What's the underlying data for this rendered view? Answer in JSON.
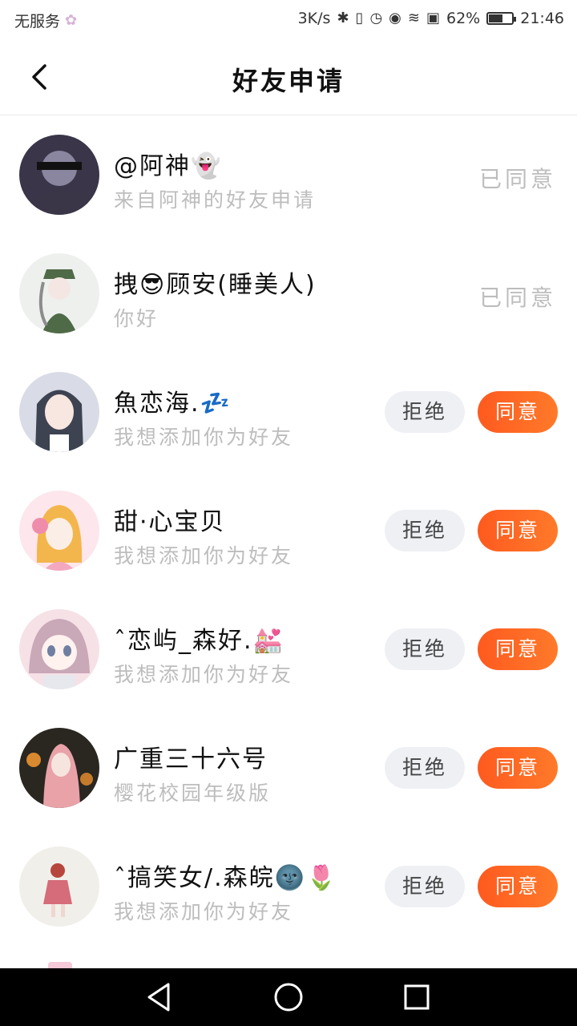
{
  "status_bar": {
    "carrier": "无服务",
    "net_speed": "3K/s",
    "battery_percent": "62%",
    "battery_level": 0.62,
    "time": "21:46",
    "icons": [
      "bluetooth-icon",
      "vibrate-icon",
      "alarm-icon",
      "eye-icon",
      "wifi-icon",
      "notice-icon",
      "battery-icon"
    ]
  },
  "header": {
    "title": "好友申请",
    "back_icon": "back-arrow-icon"
  },
  "requests": [
    {
      "name": "@阿神👻",
      "message": "来自阿神的好友申请",
      "state": "agreed",
      "state_label": "已同意",
      "avatar_colors": [
        "#3a3548",
        "#8a86a0"
      ]
    },
    {
      "name": "拽😎顾安(睡美人)",
      "message": "你好",
      "state": "agreed",
      "state_label": "已同意",
      "avatar_colors": [
        "#eef0ee",
        "#4f6a47"
      ]
    },
    {
      "name": "魚恋海.💤",
      "message": "我想添加你为好友",
      "state": "pending",
      "reject_label": "拒绝",
      "agree_label": "同意",
      "avatar_colors": [
        "#d9dce6",
        "#3e4352"
      ]
    },
    {
      "name": "甜·心宝贝",
      "message": "我想添加你为好友",
      "state": "pending",
      "reject_label": "拒绝",
      "agree_label": "同意",
      "avatar_colors": [
        "#fde6ec",
        "#f3b64d"
      ]
    },
    {
      "name": "ˆ恋屿_森好.💒",
      "message": "我想添加你为好友",
      "state": "pending",
      "reject_label": "拒绝",
      "agree_label": "同意",
      "avatar_colors": [
        "#f6e1e6",
        "#c9a8b8"
      ]
    },
    {
      "name": "广重三十六号",
      "message": "樱花校园年级版",
      "state": "pending",
      "reject_label": "拒绝",
      "agree_label": "同意",
      "avatar_colors": [
        "#2a2620",
        "#e8a2a8"
      ]
    },
    {
      "name": "ˆ搞笑女/.森皖🌚🌷",
      "message": "我想添加你为好友",
      "state": "pending",
      "reject_label": "拒绝",
      "agree_label": "同意",
      "avatar_colors": [
        "#f1efe9",
        "#d66b7a"
      ]
    }
  ],
  "nav": {
    "icons": [
      "nav-back-icon",
      "nav-home-icon",
      "nav-recents-icon"
    ]
  }
}
